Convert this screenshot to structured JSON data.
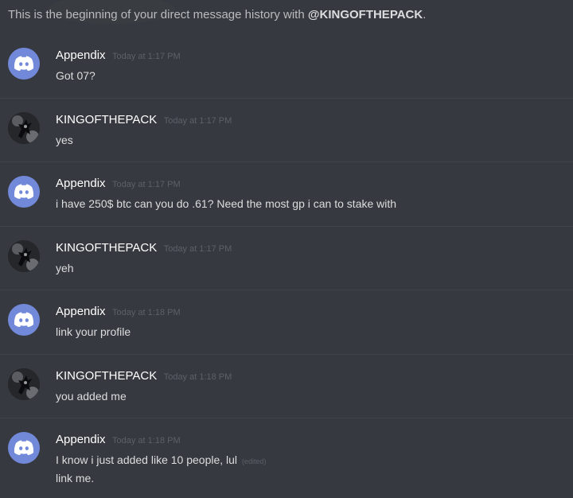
{
  "header": {
    "prefix": "This is the beginning of your direct message history with",
    "mention": "@KINGOFTHEPACK",
    "suffix": "."
  },
  "colors": {
    "background": "#36393f",
    "discord_blurple": "#7289da",
    "timestamp": "#5d6068"
  },
  "messages": [
    {
      "author": "Appendix",
      "avatar": "discord-logo-icon",
      "timestamp": "Today at 1:17 PM",
      "lines": [
        "Got 07?"
      ]
    },
    {
      "author": "KINGOFTHEPACK",
      "avatar": "custom-avatar-icon",
      "timestamp": "Today at 1:17 PM",
      "lines": [
        "yes"
      ]
    },
    {
      "author": "Appendix",
      "avatar": "discord-logo-icon",
      "timestamp": "Today at 1:17 PM",
      "lines": [
        "i have 250$ btc can you do .61? Need the most gp i can to stake with"
      ]
    },
    {
      "author": "KINGOFTHEPACK",
      "avatar": "custom-avatar-icon",
      "timestamp": "Today at 1:17 PM",
      "lines": [
        "yeh"
      ]
    },
    {
      "author": "Appendix",
      "avatar": "discord-logo-icon",
      "timestamp": "Today at 1:18 PM",
      "lines": [
        "link your profile"
      ]
    },
    {
      "author": "KINGOFTHEPACK",
      "avatar": "custom-avatar-icon",
      "timestamp": "Today at 1:18 PM",
      "lines": [
        "you added me"
      ]
    },
    {
      "author": "Appendix",
      "avatar": "discord-logo-icon",
      "timestamp": "Today at 1:18 PM",
      "lines": [
        "I know i just added like 10 people, lul",
        "link me."
      ],
      "edited_label": "(edited)"
    }
  ]
}
